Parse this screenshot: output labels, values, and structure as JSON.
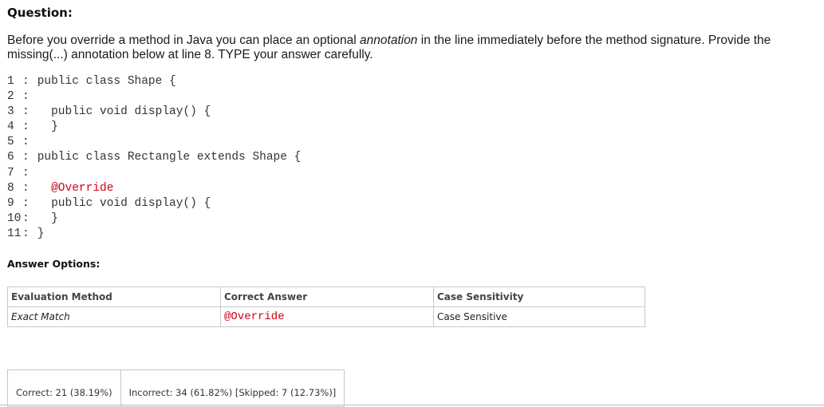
{
  "question": {
    "header": "Question:",
    "text_before": "Before you override a method in Java you can place an optional ",
    "text_em": "annotation",
    "text_after": " in the line immediately before the method signature. Provide the missing(...) annotation below at line 8. TYPE your answer carefully."
  },
  "code_lines": [
    {
      "num": "1",
      "code": "public class Shape {"
    },
    {
      "num": "2",
      "code": ""
    },
    {
      "num": "3",
      "code": "  public void display() {"
    },
    {
      "num": "4",
      "code": "  }"
    },
    {
      "num": "5",
      "code": ""
    },
    {
      "num": "6",
      "code": "public class Rectangle extends Shape {"
    },
    {
      "num": "7",
      "code": ""
    },
    {
      "num": "8",
      "code": "  @Override"
    },
    {
      "num": "9",
      "code": "  public void display() {"
    },
    {
      "num": "10",
      "code": "  }"
    },
    {
      "num": "11",
      "code": "}"
    }
  ],
  "answer_options": {
    "label": "Answer Options:",
    "headers": {
      "evaluation": "Evaluation Method",
      "correct": "Correct Answer",
      "case": "Case Sensitivity"
    },
    "row": {
      "evaluation": "Exact Match",
      "correct": "@Override",
      "case": "Case Sensitive"
    }
  },
  "stats": {
    "correct": "Correct: 21 (38.19%)",
    "incorrect": "Incorrect: 34 (61.82%) [Skipped: 7 (12.73%)]"
  },
  "colors": {
    "highlight": "#d0021b"
  }
}
